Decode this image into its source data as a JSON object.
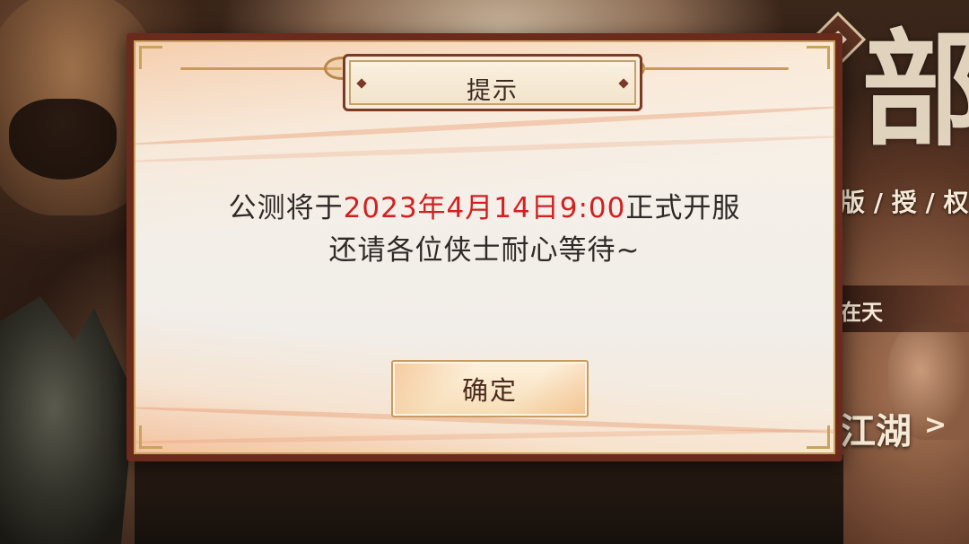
{
  "background": {
    "calligraphy": "部",
    "menu_text": "版 / 授 / 权",
    "tag_text": "在天",
    "jianghu_text": "江湖",
    "arrow_icon": "chevron-right-icon"
  },
  "dialog": {
    "title": "提示",
    "message": {
      "line1_prefix": "公测将于",
      "line1_highlight": "2023年4月14日9:00",
      "line1_suffix": "正式开服",
      "line2": "还请各位侠士耐心等待~"
    },
    "confirm_label": "确定"
  },
  "colors": {
    "highlight": "#d22121",
    "frame": "#6a2b1d",
    "gold_border": "#c9a35e",
    "text": "#2f2a27"
  }
}
